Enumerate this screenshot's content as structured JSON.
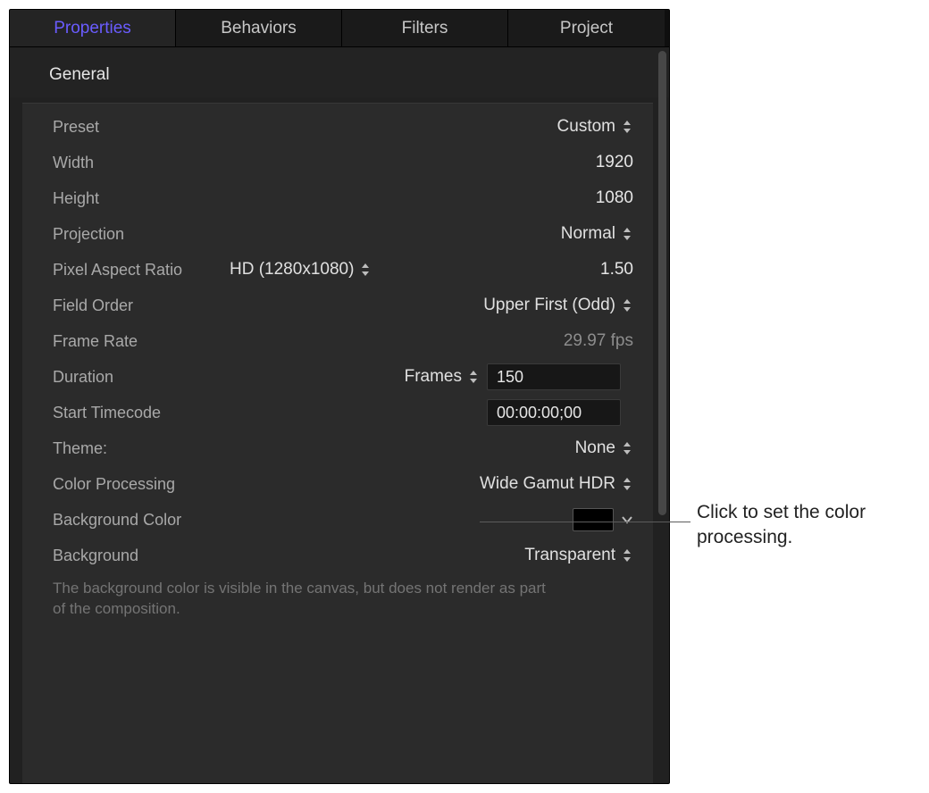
{
  "tabs": {
    "t0": "Properties",
    "t1": "Behaviors",
    "t2": "Filters",
    "t3": "Project"
  },
  "section_title": "General",
  "labels": {
    "preset": "Preset",
    "width": "Width",
    "height": "Height",
    "projection": "Projection",
    "par": "Pixel Aspect Ratio",
    "field_order": "Field Order",
    "frame_rate": "Frame Rate",
    "duration": "Duration",
    "start_tc": "Start Timecode",
    "theme": "Theme:",
    "color_proc": "Color Processing",
    "bg_color": "Background Color",
    "background": "Background"
  },
  "values": {
    "preset": "Custom",
    "width": "1920",
    "height": "1080",
    "projection": "Normal",
    "par_menu": "HD (1280x1080)",
    "par_value": "1.50",
    "field_order": "Upper First (Odd)",
    "frame_rate": "29.97 fps",
    "duration_units": "Frames",
    "duration_value": "150",
    "start_tc": "00:00:00;00",
    "theme": "None",
    "color_proc": "Wide Gamut HDR",
    "background": "Transparent"
  },
  "footnote": "The background color is visible in the canvas, but does not render as part of the composition.",
  "callout": "Click to set the color processing."
}
